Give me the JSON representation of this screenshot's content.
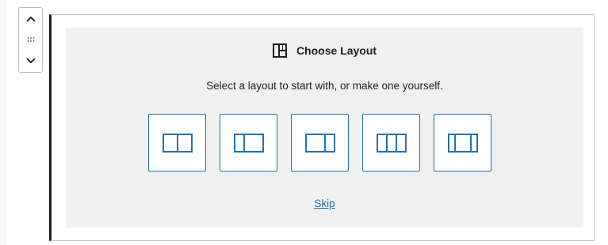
{
  "block_mover": {
    "move_up_icon": "chevron-up-icon",
    "drag_icon": "drag-handle-icon",
    "move_down_icon": "chevron-down-icon"
  },
  "placeholder": {
    "title": "Choose Layout",
    "title_icon": "columns-block-icon",
    "instructions": "Select a layout to start with, or make one yourself.",
    "layouts": [
      {
        "icon": "two-columns-icon",
        "columns": 2
      },
      {
        "icon": "two-columns-one-third-two-thirds-icon",
        "columns": 2
      },
      {
        "icon": "two-columns-two-thirds-one-third-icon",
        "columns": 2
      },
      {
        "icon": "three-columns-icon",
        "columns": 3
      },
      {
        "icon": "three-columns-wide-center-icon",
        "columns": 3
      }
    ],
    "skip_label": "Skip"
  },
  "colors": {
    "accent": "#2271b1",
    "placeholder_bg": "#f0f0f0",
    "text": "#1e1e1e"
  }
}
